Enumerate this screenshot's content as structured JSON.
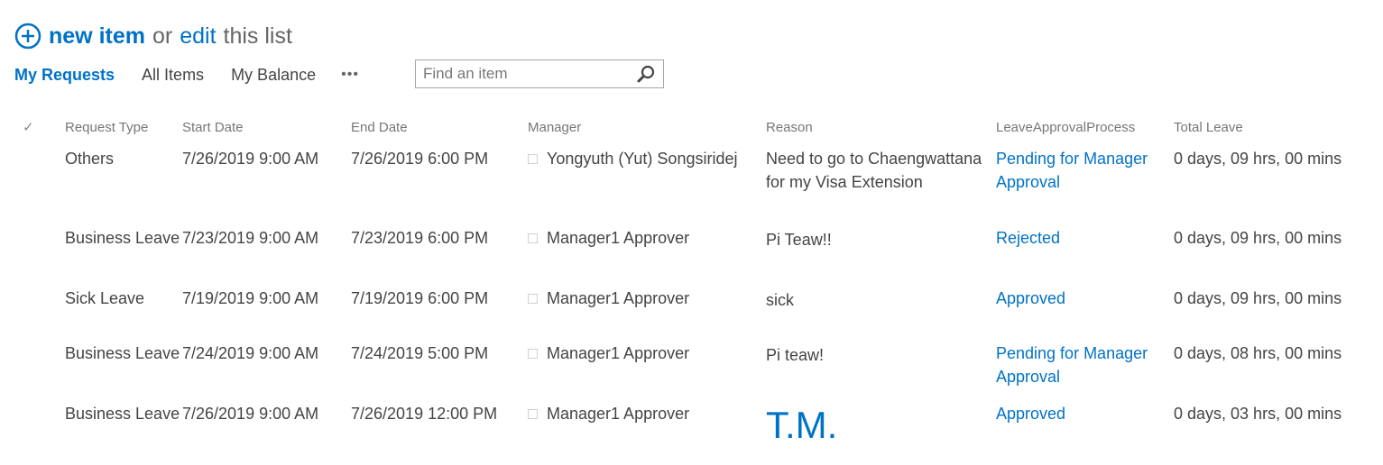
{
  "heading": {
    "new_item": "new item",
    "or": "or",
    "edit": "edit",
    "this_list": "this list"
  },
  "views": [
    {
      "label": "My Requests",
      "active": true
    },
    {
      "label": "All Items",
      "active": false
    },
    {
      "label": "My Balance",
      "active": false
    }
  ],
  "more_label": "•••",
  "search": {
    "placeholder": "Find an item",
    "value": ""
  },
  "columns": {
    "check": "✓",
    "request_type": "Request Type",
    "start_date": "Start Date",
    "end_date": "End Date",
    "manager": "Manager",
    "reason": "Reason",
    "approval": "LeaveApprovalProcess",
    "total": "Total Leave"
  },
  "rows": [
    {
      "request_type": "Others",
      "start_date": "7/26/2019 9:00 AM",
      "end_date": "7/26/2019 6:00 PM",
      "manager": "Yongyuth (Yut) Songsiridej",
      "reason": "Need to go to Chaengwattana for my Visa Extension",
      "approval": "Pending for Manager Approval",
      "total": "0 days, 09 hrs, 00 mins"
    },
    {
      "request_type": "Business Leave",
      "start_date": "7/23/2019 9:00 AM",
      "end_date": "7/23/2019 6:00 PM",
      "manager": "Manager1 Approver",
      "reason": "Pi Teaw!!",
      "approval": "Rejected",
      "total": "0 days, 09 hrs, 00 mins"
    },
    {
      "request_type": "Sick Leave",
      "start_date": "7/19/2019 9:00 AM",
      "end_date": "7/19/2019 6:00 PM",
      "manager": "Manager1 Approver",
      "reason": "sick",
      "approval": "Approved",
      "total": "0 days, 09 hrs, 00 mins"
    },
    {
      "request_type": "Business Leave",
      "start_date": "7/24/2019 9:00 AM",
      "end_date": "7/24/2019 5:00 PM",
      "manager": "Manager1 Approver",
      "reason": "Pi teaw!",
      "approval": "Pending for Manager Approval",
      "total": "0 days, 08 hrs, 00 mins"
    },
    {
      "request_type": "Business Leave",
      "start_date": "7/26/2019 9:00 AM",
      "end_date": "7/26/2019 12:00 PM",
      "manager": "Manager1 Approver",
      "reason": "T.M.",
      "approval": "Approved",
      "total": "0 days, 03 hrs, 00 mins"
    }
  ],
  "colors": {
    "accent": "#0072c6",
    "text": "#444444",
    "header_text": "#777777"
  }
}
